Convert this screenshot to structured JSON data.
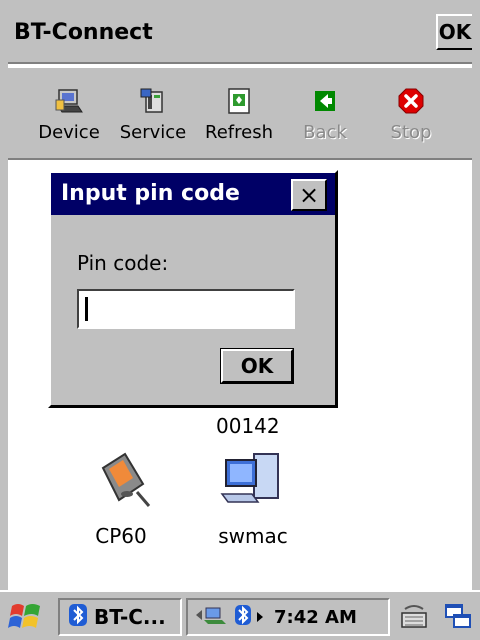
{
  "app": {
    "title": "BT-Connect",
    "ok_label": "OK"
  },
  "toolbar": {
    "buttons": [
      {
        "label": "Device",
        "icon": "device-icon",
        "enabled": true
      },
      {
        "label": "Service",
        "icon": "service-icon",
        "enabled": true
      },
      {
        "label": "Refresh",
        "icon": "refresh-icon",
        "enabled": true
      },
      {
        "label": "Back",
        "icon": "back-arrow-icon",
        "enabled": false
      },
      {
        "label": "Stop",
        "icon": "stop-icon",
        "enabled": false
      }
    ]
  },
  "devices": [
    {
      "label": "00142",
      "icon": "computer-icon"
    },
    {
      "label": "CP60",
      "icon": "pda-icon"
    },
    {
      "label": "swmac",
      "icon": "computer-icon"
    }
  ],
  "dialog": {
    "title": "Input pin code",
    "close_label": "×",
    "pin_label": "Pin code:",
    "pin_value": "",
    "ok_label": "OK"
  },
  "taskbar": {
    "task_label": "BT-C...",
    "time": "7:42 AM"
  },
  "colors": {
    "face": "#c0c0c0",
    "dialog_title_bg": "#000066",
    "stop_red": "#dd0000",
    "back_green": "#008800"
  }
}
